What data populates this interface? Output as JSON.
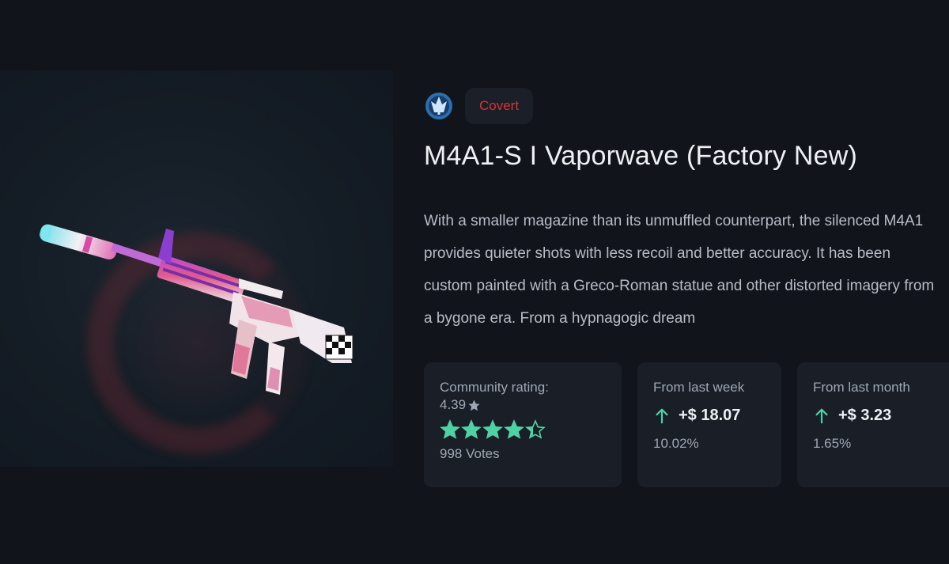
{
  "item": {
    "rarity": "Covert",
    "rarity_color": "#e0312e",
    "collection_icon": "collection-emblem-icon",
    "title": "M4A1-S I Vaporwave (Factory New)",
    "description": "With a smaller magazine than its unmuffled counterpart, the silenced M4A1 provides quieter shots with less recoil and better accuracy. It has been custom painted with a Greco-Roman statue and other distorted imagery from a bygone era. From a hypnagogic dream"
  },
  "rating": {
    "label": "Community rating:",
    "value": "4.39",
    "value_icon": "star-icon",
    "stars_filled": 4.39,
    "stars_max": 5,
    "star_color": "#4fd1a5",
    "votes": "998 Votes"
  },
  "week": {
    "label": "From last week",
    "change": "+$ 18.07",
    "percent": "10.02%",
    "trend_icon": "arrow-up-icon"
  },
  "month": {
    "label": "From last month",
    "change": "+$ 3.23",
    "percent": "1.65%",
    "trend_icon": "arrow-up-icon"
  },
  "colors": {
    "accent_green": "#4fd1a5",
    "card_bg": "#191e27",
    "page_bg": "#11141b"
  }
}
